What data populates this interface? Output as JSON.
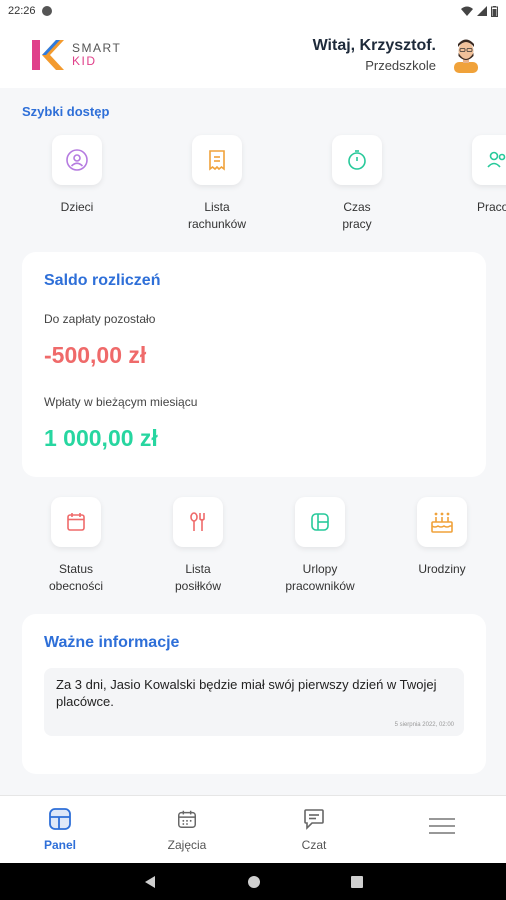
{
  "status_bar": {
    "time": "22:26"
  },
  "header": {
    "logo_line1": "SMART",
    "logo_line2": "KID",
    "greeting": "Witaj, Krzysztof.",
    "organization": "Przedszkole"
  },
  "quick_access": {
    "title": "Szybki dostęp",
    "items": [
      {
        "label": "Dzieci",
        "icon": "child-icon"
      },
      {
        "label": "Lista\nrachunków",
        "icon": "receipt-icon"
      },
      {
        "label": "Czas\npracy",
        "icon": "stopwatch-icon"
      },
      {
        "label": "Pracow",
        "icon": "employees-icon"
      }
    ]
  },
  "balance": {
    "title": "Saldo rozliczeń",
    "due_label": "Do zapłaty pozostało",
    "due_value": "-500,00 zł",
    "paid_label": "Wpłaty w bieżącym miesiącu",
    "paid_value": "1 000,00 zł"
  },
  "second_row": {
    "items": [
      {
        "label": "Status\nobecności",
        "icon": "calendar-icon"
      },
      {
        "label": "Lista\nposiłków",
        "icon": "cutlery-icon"
      },
      {
        "label": "Urlopy\npracowników",
        "icon": "leave-icon"
      },
      {
        "label": "Urodziny",
        "icon": "birthday-cake-icon"
      }
    ]
  },
  "info": {
    "title": "Ważne informacje",
    "message": "Za 3 dni, Jasio Kowalski będzie miał swój pierwszy dzień w Twojej placówce.",
    "date": "5 sierpnia 2022, 02:00"
  },
  "bottom_nav": {
    "items": [
      {
        "label": "Panel",
        "icon": "panel-icon",
        "active": true
      },
      {
        "label": "Zajęcia",
        "icon": "calendar-icon",
        "active": false
      },
      {
        "label": "Czat",
        "icon": "chat-icon",
        "active": false
      },
      {
        "label": "",
        "icon": "menu-icon",
        "active": false
      }
    ]
  },
  "colors": {
    "accent": "#2e6fd8",
    "negative": "#ef6a6a",
    "positive": "#27d6a0"
  }
}
